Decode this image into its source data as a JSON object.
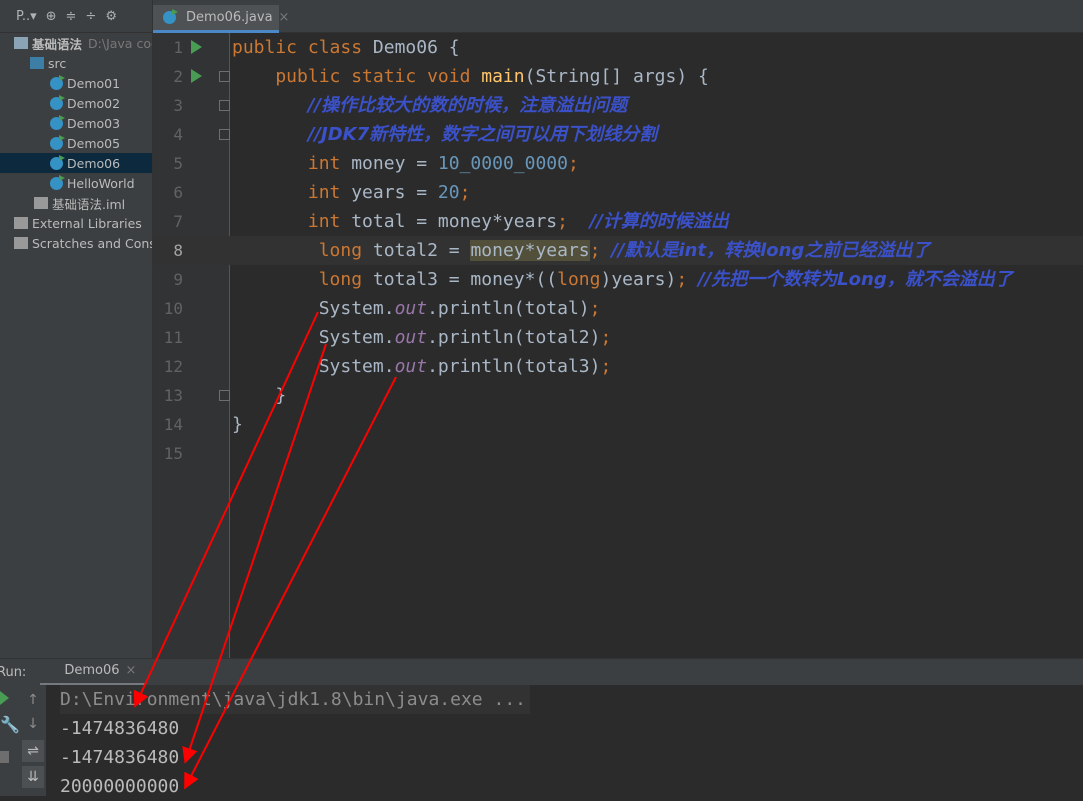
{
  "project_toolbar": {
    "label": "P..▾"
  },
  "tree": [
    {
      "label": "基础语法",
      "hint": "D:\\Java code",
      "indent": 14,
      "icon": "module-icon"
    },
    {
      "label": "src",
      "indent": 30,
      "icon": "folder-icon"
    },
    {
      "label": "Demo01",
      "indent": 50,
      "icon": "class-icon"
    },
    {
      "label": "Demo02",
      "indent": 50,
      "icon": "class-icon"
    },
    {
      "label": "Demo03",
      "indent": 50,
      "icon": "class-icon"
    },
    {
      "label": "Demo05",
      "indent": 50,
      "icon": "class-icon"
    },
    {
      "label": "Demo06",
      "indent": 50,
      "icon": "class-icon",
      "selected": true
    },
    {
      "label": "HelloWorld",
      "indent": 50,
      "icon": "class-icon"
    },
    {
      "label": "基础语法.iml",
      "indent": 34,
      "icon": "file-icon"
    },
    {
      "label": "External Libraries",
      "indent": 14,
      "icon": "library-icon"
    },
    {
      "label": "Scratches and Consoles",
      "indent": 14,
      "icon": "scratches-icon"
    }
  ],
  "editor_tab": {
    "label": "Demo06.java"
  },
  "code": [
    [
      [
        "public class ",
        "kw"
      ],
      [
        "Demo06 {",
        ""
      ]
    ],
    [
      [
        "    public static void ",
        "kw"
      ],
      [
        "main",
        "mth"
      ],
      [
        "(String[] args) {",
        ""
      ]
    ],
    [
      [
        "       ",
        ""
      ],
      [
        "//操作比较大的数的时候，注意溢出问题",
        "cm"
      ]
    ],
    [
      [
        "       ",
        ""
      ],
      [
        "//JDK7新特性，数字之间可以用下划线分割",
        "cm"
      ]
    ],
    [
      [
        "       ",
        ""
      ],
      [
        "int ",
        "kw"
      ],
      [
        "money = ",
        ""
      ],
      [
        "10_0000_0000",
        "num"
      ],
      [
        ";",
        "kw"
      ]
    ],
    [
      [
        "       ",
        ""
      ],
      [
        "int ",
        "kw"
      ],
      [
        "years = ",
        ""
      ],
      [
        "20",
        "num"
      ],
      [
        ";",
        "kw"
      ]
    ],
    [
      [
        "       ",
        ""
      ],
      [
        "int ",
        "kw"
      ],
      [
        "total = money*years",
        ""
      ],
      [
        ";  ",
        "kw"
      ],
      [
        "//计算的时候溢出",
        "cm"
      ]
    ],
    [
      [
        "        ",
        ""
      ],
      [
        "long ",
        "kw"
      ],
      [
        "total2 = ",
        ""
      ],
      [
        "money*years",
        "hl"
      ],
      [
        "; ",
        "kw"
      ],
      [
        "//默认是int，转换long之前已经溢出了",
        "cm"
      ]
    ],
    [
      [
        "        ",
        ""
      ],
      [
        "long ",
        "kw"
      ],
      [
        "total3 = money*((",
        ""
      ],
      [
        "long",
        "kw"
      ],
      [
        ")years)",
        ""
      ],
      [
        "; ",
        "kw"
      ],
      [
        "//先把一个数转为Long，就不会溢出了",
        "cm"
      ]
    ],
    [
      [
        "        System.",
        ""
      ],
      [
        "out",
        "fld"
      ],
      [
        ".println(total)",
        ""
      ],
      [
        ";",
        "kw"
      ]
    ],
    [
      [
        "        System.",
        ""
      ],
      [
        "out",
        "fld"
      ],
      [
        ".println(total2)",
        ""
      ],
      [
        ";",
        "kw"
      ]
    ],
    [
      [
        "        System.",
        ""
      ],
      [
        "out",
        "fld"
      ],
      [
        ".println(total3)",
        ""
      ],
      [
        ";",
        "kw"
      ]
    ],
    [
      [
        "    }",
        ""
      ]
    ],
    [
      [
        "}",
        ""
      ]
    ],
    [
      [
        "",
        ""
      ]
    ]
  ],
  "current_line": 8,
  "run_lines": [
    1,
    2
  ],
  "fold_lines": [
    2,
    3,
    4,
    13
  ],
  "run_panel": {
    "label": "Run:",
    "tab": "Demo06"
  },
  "console": [
    "D:\\Environment\\java\\jdk1.8\\bin\\java.exe ...",
    "-1474836480",
    "-1474836480",
    "20000000000"
  ],
  "colors": {
    "keyword": "#cc7832",
    "number": "#6897bb",
    "comment": "#3b51c9",
    "arrow": "#ff0000"
  }
}
